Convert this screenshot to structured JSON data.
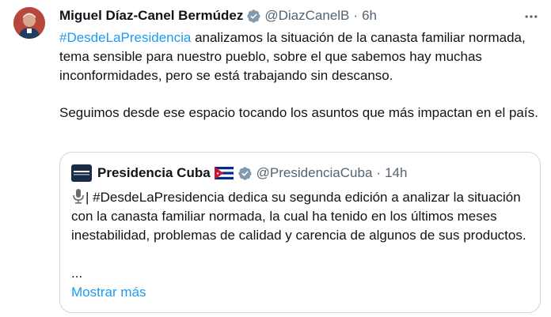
{
  "tweet": {
    "author_name": "Miguel Díaz-Canel Bermúdez",
    "handle": "@DiazCanelB",
    "separator": "·",
    "time": "6h",
    "hashtag": "#DesdeLaPresidencia",
    "text_1_rest": " analizamos la situación de la canasta familiar normada, tema sensible para nuestro pueblo, sobre el que sabemos hay muchas inconformidades, pero se está trabajando sin descanso.",
    "text_2": "Seguimos desde ese espacio tocando los asuntos que más impactan en el país.",
    "more_icon": "more-horizontal-icon",
    "verified_icon": "verified-badge-icon"
  },
  "quote": {
    "author_name": "Presidencia Cuba",
    "handle": "@PresidenciaCuba",
    "separator": "·",
    "time": "14h",
    "logo_icon": "presidencia-logo",
    "flag_icon": "cuba-flag-icon",
    "mic_icon": "microphone-icon",
    "text": "| #DesdeLaPresidencia dedica su segunda edición a analizar la situación con la canasta familiar normada, la cual ha tenido en los últimos meses inestabilidad, problemas de calidad y carencia de algunos de sus productos.",
    "ellipsis": "...",
    "show_more": "Mostrar más"
  },
  "colors": {
    "accent": "#1d9bf0",
    "text": "#0f1419",
    "secondary": "#536471",
    "border": "#cfd9de"
  }
}
